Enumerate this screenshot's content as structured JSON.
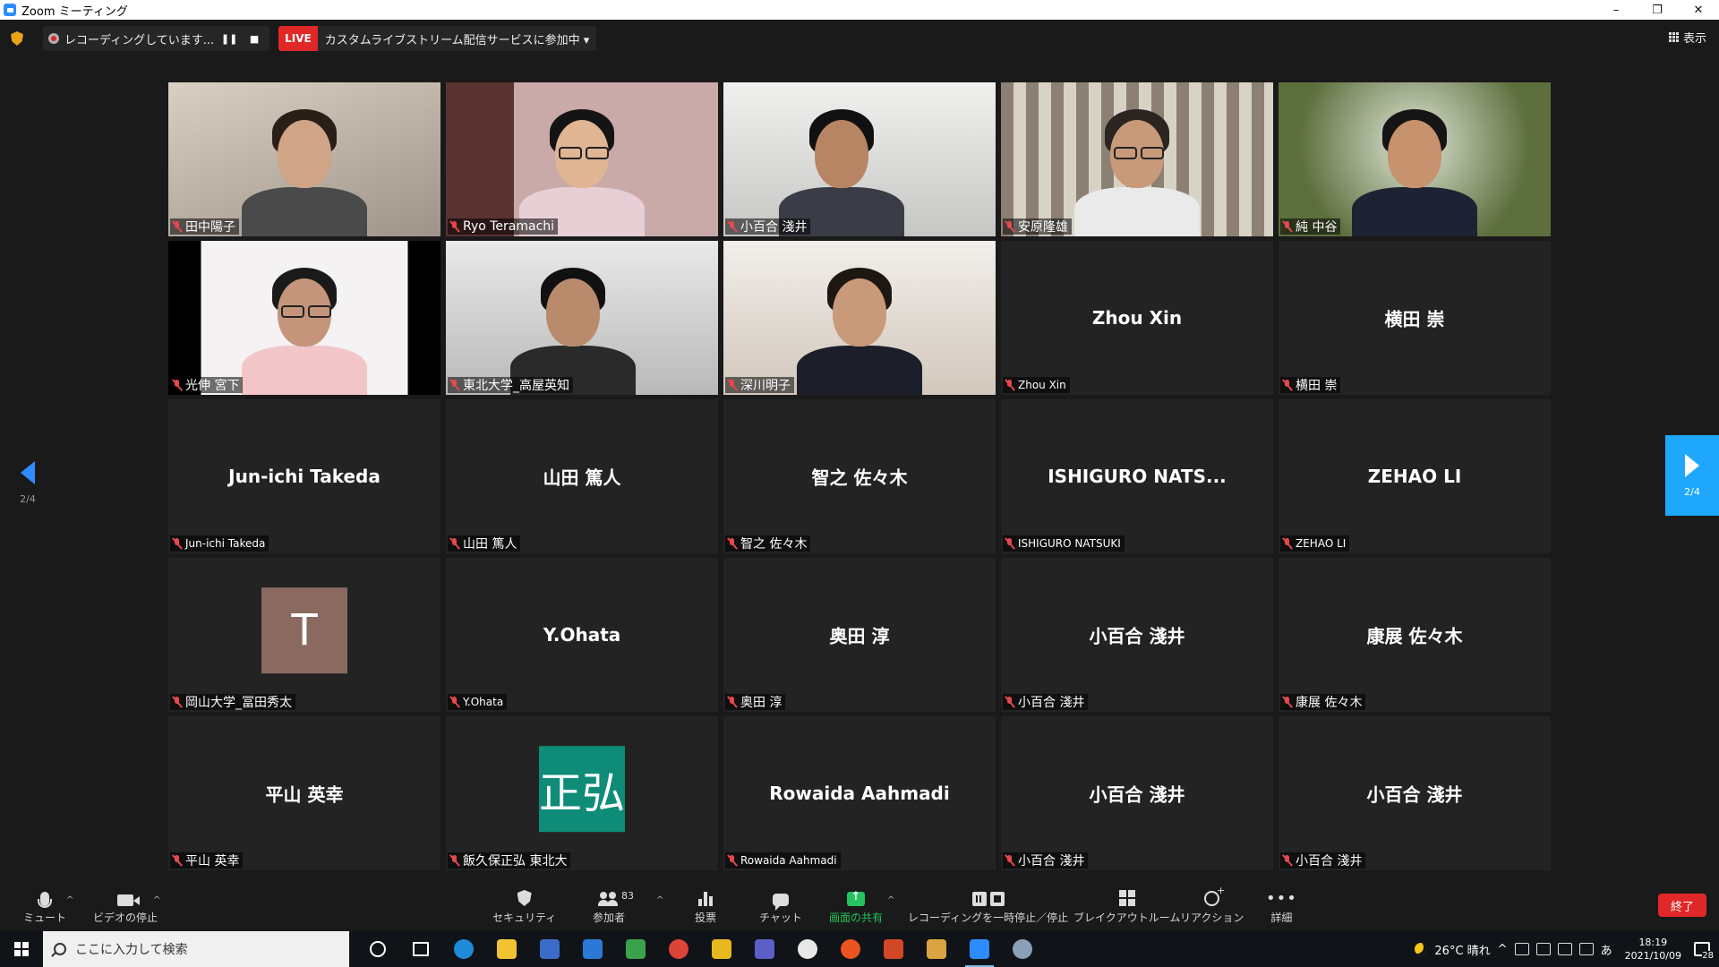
{
  "window": {
    "title": "Zoom ミーティング",
    "controls": [
      "–",
      "❐",
      "✕"
    ]
  },
  "topbar": {
    "recording_text": "レコーディングしています...",
    "live_badge": "LIVE",
    "live_text": "カスタムライブストリーム配信サービスに参加中 ▾",
    "view_label": "表示"
  },
  "tiles": [
    {
      "label": "田中陽子",
      "type": "video"
    },
    {
      "label": "Ryo Teramachi",
      "type": "video"
    },
    {
      "label": "小百合 淺井",
      "type": "video"
    },
    {
      "label": "安原隆雄",
      "type": "video"
    },
    {
      "label": "純 中谷",
      "type": "video"
    },
    {
      "label": "光伸 宮下",
      "type": "video"
    },
    {
      "label": "東北大学_高屋英知",
      "type": "video"
    },
    {
      "label": "深川明子",
      "type": "video"
    },
    {
      "label": "Zhou Xin",
      "center": "Zhou Xin",
      "type": "name"
    },
    {
      "label": "横田 崇",
      "center": "横田 崇",
      "type": "name"
    },
    {
      "label": "Jun-ichi Takeda",
      "center": "Jun-ichi Takeda",
      "type": "name"
    },
    {
      "label": "山田 篤人",
      "center": "山田 篤人",
      "type": "name"
    },
    {
      "label": "智之 佐々木",
      "center": "智之 佐々木",
      "type": "name"
    },
    {
      "label": "ISHIGURO NATSUKI",
      "center": "ISHIGURO  NATS...",
      "type": "name"
    },
    {
      "label": "ZEHAO LI",
      "center": "ZEHAO LI",
      "type": "name"
    },
    {
      "label": "岡山大学_冨田秀太",
      "avatar": "T",
      "avatar_color": "#8a6a60",
      "type": "avatar"
    },
    {
      "label": "Y.Ohata",
      "center": "Y.Ohata",
      "type": "name"
    },
    {
      "label": "奥田  淳",
      "center": "奥田  淳",
      "type": "name"
    },
    {
      "label": "小百合 淺井",
      "center": "小百合 淺井",
      "type": "name"
    },
    {
      "label": "康展 佐々木",
      "center": "康展 佐々木",
      "type": "name"
    },
    {
      "label": "平山  英幸",
      "center": "平山  英幸",
      "type": "name"
    },
    {
      "label": "飯久保正弘  東北大",
      "avatar": "正弘",
      "avatar_color": "#0e8c78",
      "type": "avatar"
    },
    {
      "label": "Rowaida Aahmadi",
      "center": "Rowaida Aahmadi",
      "type": "name"
    },
    {
      "label": "小百合 淺井",
      "center": "小百合 淺井",
      "type": "name"
    },
    {
      "label": "小百合 淺井",
      "center": "小百合 淺井",
      "type": "name"
    }
  ],
  "pagination": {
    "left": "2/4",
    "right": "2/4"
  },
  "controls": {
    "mute": "ミュート",
    "video": "ビデオの停止",
    "security": "セキュリティ",
    "participants": "参加者",
    "participant_count": "83",
    "polls": "投票",
    "chat": "チャット",
    "share": "画面の共有",
    "pause_recording": "レコーディングを一時停止／停止",
    "breakout": "ブレイクアウトルーム",
    "reactions": "リアクション",
    "more": "詳細",
    "end": "終了"
  },
  "taskbar": {
    "search_placeholder": "ここに入力して検索",
    "weather": "26°C  晴れ",
    "ime": "あ",
    "time": "18:19",
    "date": "2021/10/09",
    "notifications": "28",
    "apps": [
      {
        "name": "cortana",
        "color": "#101318"
      },
      {
        "name": "task-view",
        "color": "#101318"
      },
      {
        "name": "edge",
        "color": "#1f8ad6"
      },
      {
        "name": "explorer",
        "color": "#f2c230"
      },
      {
        "name": "store",
        "color": "#3b6cc9"
      },
      {
        "name": "mail",
        "color": "#2a79d6"
      },
      {
        "name": "terminal",
        "color": "#3aa24a"
      },
      {
        "name": "chrome",
        "color": "#db4437"
      },
      {
        "name": "notes",
        "color": "#e8b820"
      },
      {
        "name": "teams",
        "color": "#5b5fc7"
      },
      {
        "name": "slack",
        "color": "#e8e8e8"
      },
      {
        "name": "ubuntu",
        "color": "#e95420"
      },
      {
        "name": "powerpoint",
        "color": "#d24726"
      },
      {
        "name": "paint",
        "color": "#d9a441"
      },
      {
        "name": "zoom",
        "color": "#2D8CFF"
      },
      {
        "name": "app",
        "color": "#8aa0b8"
      }
    ]
  }
}
